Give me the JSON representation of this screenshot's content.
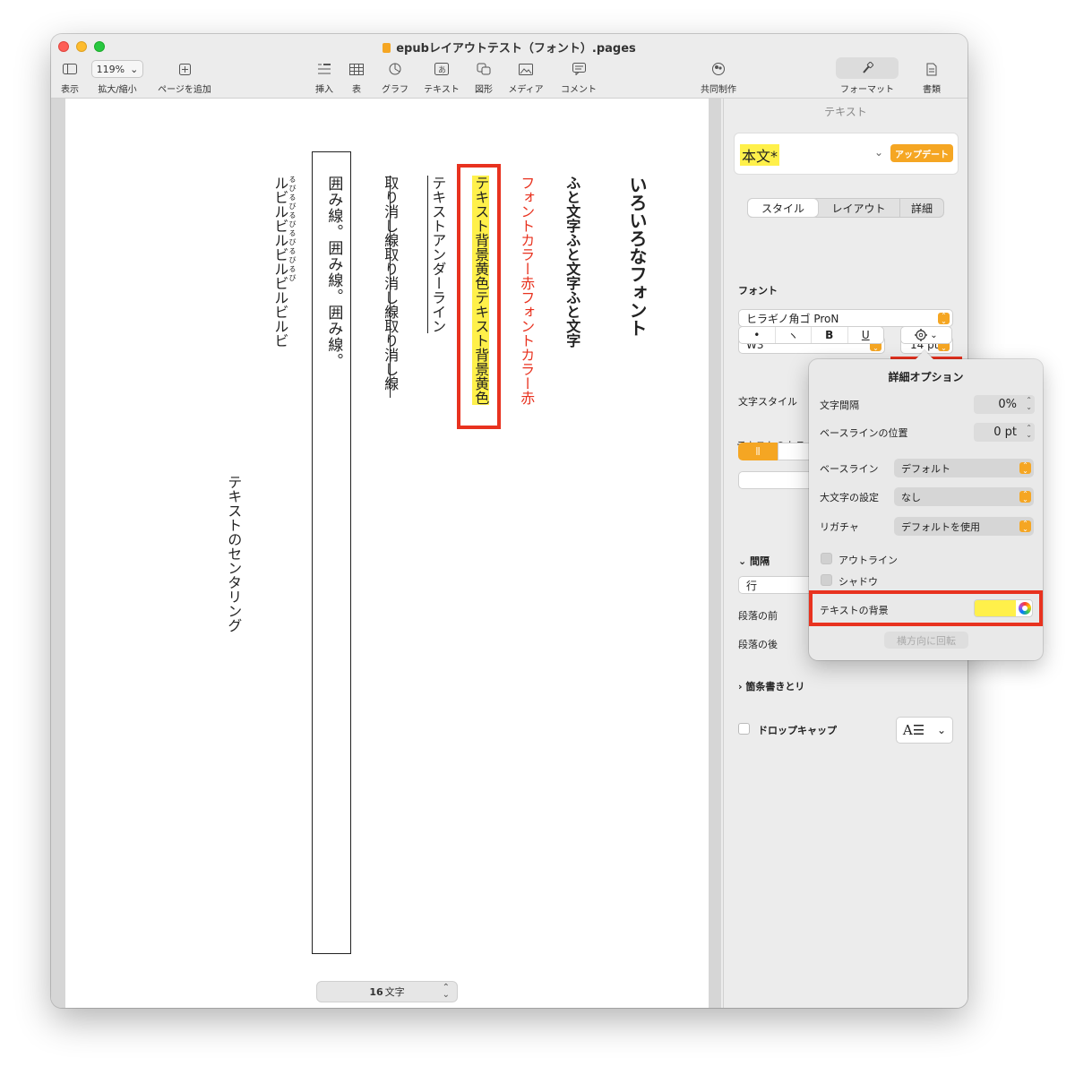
{
  "window": {
    "title": "epubレイアウトテスト（フォント）.pages"
  },
  "toolbar": {
    "view_label": "表示",
    "zoom_value": "119%",
    "zoom_label": "拡大/縮小",
    "add_page_label": "ページを追加",
    "insert_label": "挿入",
    "table_label": "表",
    "chart_label": "グラフ",
    "text_label": "テキスト",
    "shape_label": "図形",
    "media_label": "メディア",
    "comment_label": "コメント",
    "collaborate_label": "共同制作",
    "format_label": "フォーマット",
    "document_label": "書類"
  },
  "document": {
    "columns": [
      {
        "text": "いろいろなフォント",
        "style": "heading"
      },
      {
        "text": "ふと文字ふと文字ふと文字",
        "style": "bold"
      },
      {
        "text": "フォントカラー赤フォントカラー赤",
        "style": "red",
        "color": "#e8321f"
      },
      {
        "text": "テキスト背景黄色テキスト背景黄色",
        "style": "highlight",
        "color": "#fff04a"
      },
      {
        "text": "テキストアンダーライン",
        "style": "underline"
      },
      {
        "text": "取り消し線取り消し線取り消し線",
        "style": "strike"
      },
      {
        "text": "囲み線。囲み線。囲み線。",
        "style": "boxed"
      },
      {
        "text": "ルビルビルビルビルビルビ",
        "style": "ruby",
        "ruby": "るびるびるびるびるびるび"
      },
      {
        "text": "テキストのセンタリング",
        "style": "centered"
      }
    ],
    "word_count": "16",
    "word_count_unit": "文字"
  },
  "sidebar": {
    "pane_title": "テキスト",
    "paragraph_style": "本文*",
    "update_button": "アップデート",
    "tabs": [
      "スタイル",
      "レイアウト",
      "詳細"
    ],
    "font_label": "フォント",
    "font_family": "ヒラギノ角ゴ ProN",
    "font_weight": "W3",
    "font_size": "14 pt",
    "bold_label": "B",
    "underline_label": "U",
    "char_style_label": "文字スタイル",
    "text_color_label": "テキストのカラー",
    "spacing_label": "間隔",
    "line_label": "行",
    "before_para_label": "段落の前",
    "after_para_label": "段落の後",
    "bullets_label": "箇条書きとリ",
    "dropcap_label": "ドロップキャップ",
    "accent_color": "#f5a623"
  },
  "popover": {
    "title": "詳細オプション",
    "char_spacing_label": "文字間隔",
    "char_spacing_value": "0%",
    "baseline_shift_label": "ベースラインの位置",
    "baseline_shift_value": "0 pt",
    "baseline_label": "ベースライン",
    "baseline_value": "デフォルト",
    "capitalization_label": "大文字の設定",
    "capitalization_value": "なし",
    "ligature_label": "リガチャ",
    "ligature_value": "デフォルトを使用",
    "outline_label": "アウトライン",
    "shadow_label": "シャドウ",
    "text_bg_label": "テキストの背景",
    "text_bg_color": "#fff04a",
    "rotate_button": "横方向に回転"
  },
  "annotation_color": "#e8321f"
}
